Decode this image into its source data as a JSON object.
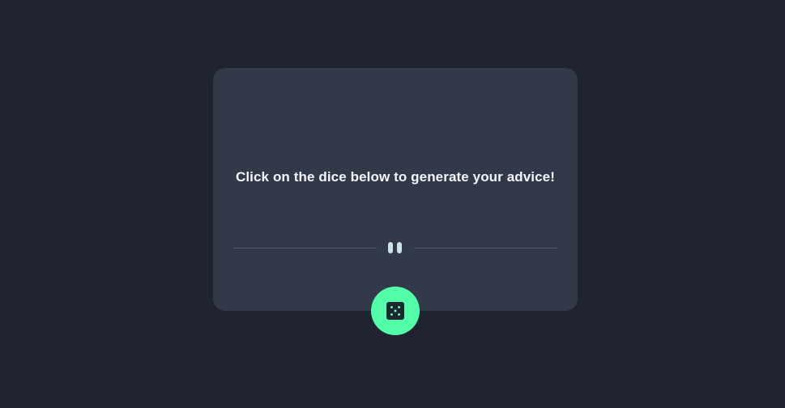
{
  "advice": {
    "text": "Click on the dice below to generate your advice!"
  },
  "divider": {
    "icon": "pause-icon"
  },
  "dice_button": {
    "icon": "dice-icon"
  },
  "colors": {
    "background": "#1f2430",
    "card": "#323a4a",
    "text": "#f3f6fb",
    "divider_line": "#4e5a6b",
    "pause_bars": "#cee3e9",
    "accent": "#52ffa8",
    "dice_face": "#1f2632"
  }
}
